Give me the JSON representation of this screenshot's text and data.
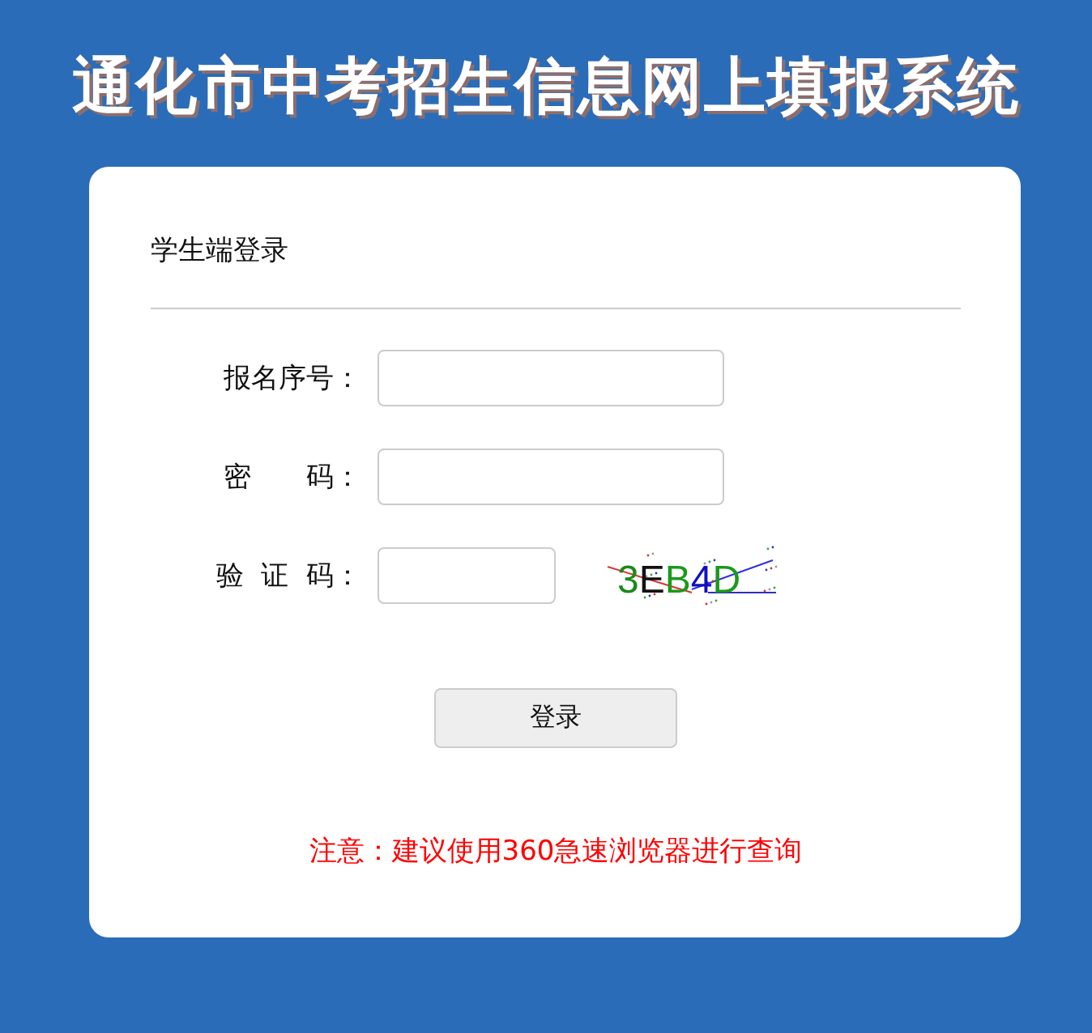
{
  "title": "通化市中考招生信息网上填报系统",
  "login_card": {
    "heading": "学生端登录",
    "fields": [
      {
        "kind": "text",
        "label": "报名序号："
      },
      {
        "kind": "password",
        "label": "密　　码："
      },
      {
        "kind": "captcha",
        "label": "验  证  码：",
        "captcha_text": "3EB4D"
      }
    ],
    "submit_button": "登录",
    "notice": "注意：建议使用360急速浏览器进行查询"
  }
}
